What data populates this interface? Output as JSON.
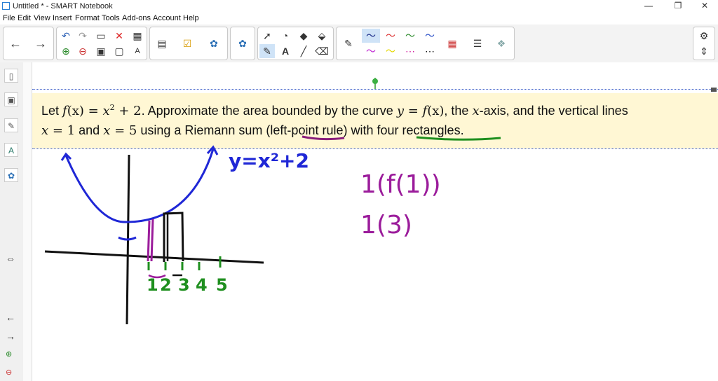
{
  "window": {
    "title": "Untitled * - SMART Notebook",
    "minimize": "—",
    "restore": "❐",
    "close": "✕"
  },
  "menu": [
    "File",
    "Edit",
    "View",
    "Insert",
    "Format",
    "Tools",
    "Add-ons",
    "Account",
    "Help"
  ],
  "problem": {
    "p1": "Let ",
    "f": "f",
    "paren_x": "(x)",
    "eq": " = ",
    "x": "x",
    "sq": "2",
    "plus2": " + 2",
    "p2": ". Approximate the area bounded by the curve ",
    "y": "y",
    "eq2": " = ",
    "f2": "f",
    "paren_x2": "(x)",
    "p3": ", the ",
    "x2": "x",
    "p4": "-axis, and the vertical lines",
    "l2x": "x",
    "eq3": " = 1",
    "and": " and ",
    "l2x2": "x",
    "eq4": " = 5",
    "p5": " using a Riemann sum (",
    "lp": "left-point",
    "p6": " rule) with ",
    "fr": "four rectangles",
    "p7": "."
  },
  "handwriting": {
    "equation": "y=x²+2",
    "work_line1": "1(f(1))",
    "work_line2": "1(3)",
    "ticks": [
      "1",
      "2",
      "3",
      "4",
      "5"
    ]
  },
  "colors": {
    "blue_ink": "#1f27d6",
    "purple_ink": "#9b1c9b",
    "green_ink": "#1f8f1f",
    "black_ink": "#111111",
    "underline_purple": "#8a1f7c",
    "underline_green": "#1f8f1f"
  }
}
